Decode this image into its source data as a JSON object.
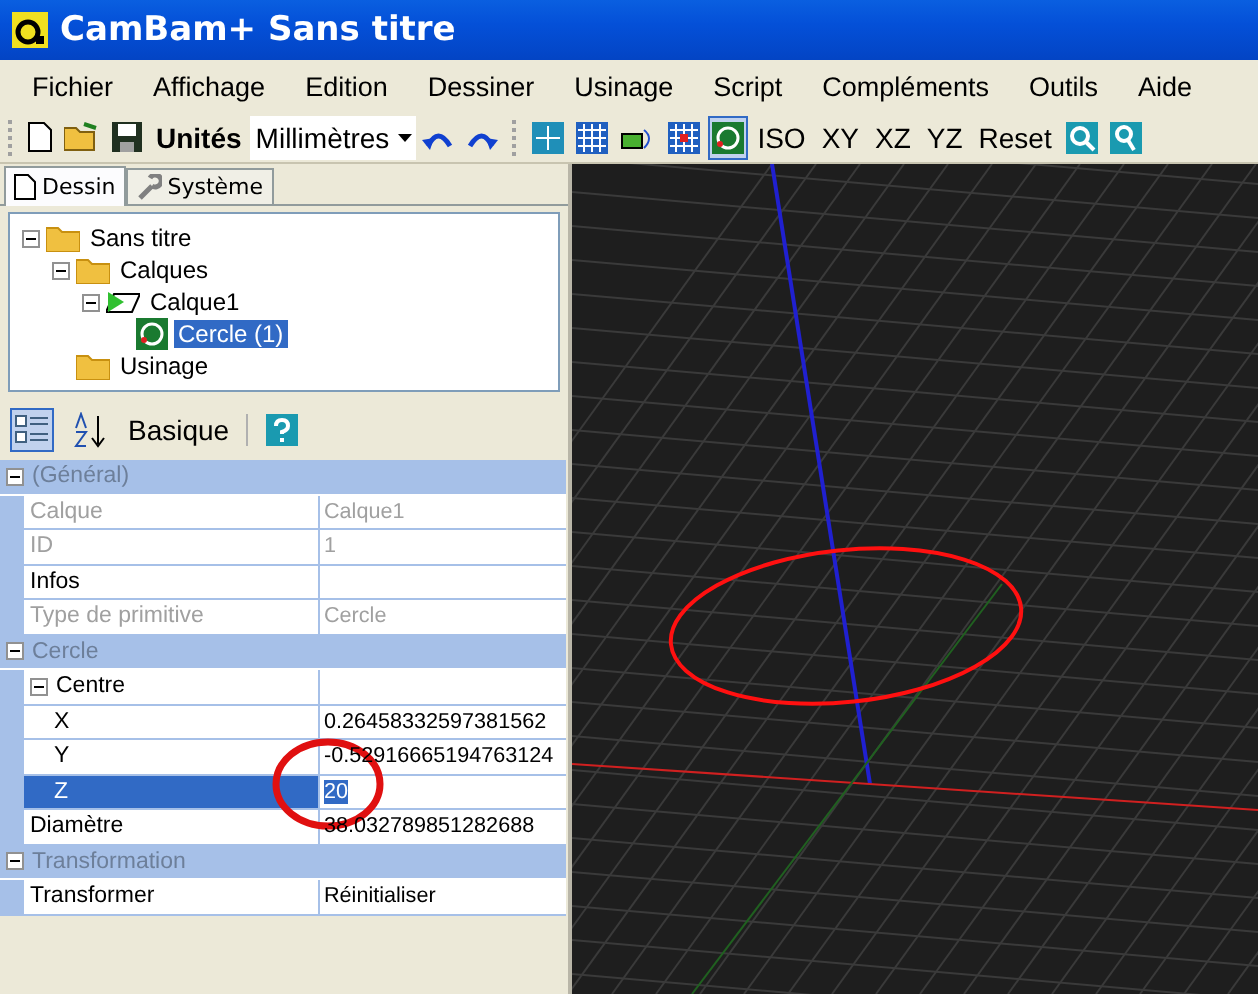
{
  "window": {
    "title": "CamBam+  Sans titre"
  },
  "menu": [
    "Fichier",
    "Affichage",
    "Edition",
    "Dessiner",
    "Usinage",
    "Script",
    "Compléments",
    "Outils",
    "Aide"
  ],
  "toolbar": {
    "units_label": "Unités",
    "units_value": "Millimètres",
    "view_buttons": [
      {
        "kind": "icon",
        "selected": false
      },
      {
        "kind": "icon",
        "selected": false
      },
      {
        "kind": "icon",
        "selected": false
      },
      {
        "kind": "icon",
        "selected": false
      },
      {
        "kind": "icon",
        "selected": true
      },
      {
        "kind": "text",
        "label": "ISO",
        "selected": false
      },
      {
        "kind": "text",
        "label": "XY",
        "selected": false
      },
      {
        "kind": "text",
        "label": "XZ",
        "selected": false
      },
      {
        "kind": "text",
        "label": "YZ",
        "selected": false
      },
      {
        "kind": "text",
        "label": "Reset",
        "selected": false
      },
      {
        "kind": "icon",
        "selected": false
      },
      {
        "kind": "icon",
        "selected": false
      }
    ]
  },
  "tabs": [
    {
      "label": "Dessin",
      "selected": true
    },
    {
      "label": "Système",
      "selected": false
    }
  ],
  "tree": [
    {
      "label": "Sans titre",
      "kind": "folder",
      "expanded": true,
      "selected": false,
      "children": [
        {
          "label": "Calques",
          "kind": "folder",
          "expanded": true,
          "selected": false,
          "children": [
            {
              "label": "Calque1",
              "kind": "layer",
              "expanded": true,
              "selected": false,
              "children": [
                {
                  "label": "Cercle (1)",
                  "kind": "shape",
                  "selected": true
                }
              ]
            }
          ]
        },
        {
          "label": "Usinage",
          "kind": "folder",
          "selected": false
        }
      ]
    }
  ],
  "properties_toolbar": {
    "sort_label": "Basique"
  },
  "properties": [
    {
      "kind": "category",
      "label": "(Général)",
      "expanded": true
    },
    {
      "kind": "property",
      "name": "Calque",
      "value": "Calque1",
      "disabled": true,
      "selected": false
    },
    {
      "kind": "property",
      "name": "ID",
      "value": "1",
      "disabled": true,
      "selected": false
    },
    {
      "kind": "property",
      "name": "Infos",
      "disabled": false,
      "selected": false
    },
    {
      "kind": "property",
      "name": "Type de primitive",
      "value": "Cercle",
      "disabled": true,
      "selected": false
    },
    {
      "kind": "category",
      "label": "Cercle",
      "expanded": true
    },
    {
      "kind": "group",
      "name": "Centre",
      "expanded": true
    },
    {
      "kind": "subproperty",
      "name": "X",
      "value": "0.26458332597381562",
      "disabled": false,
      "selected": false
    },
    {
      "kind": "subproperty",
      "name": "Y",
      "value": "-0.52916665194763124",
      "disabled": false,
      "selected": false
    },
    {
      "kind": "subproperty",
      "name": "Z",
      "value": "20",
      "disabled": false,
      "selected": true
    },
    {
      "kind": "property",
      "name": "Diamètre",
      "value": "38.032789851282688",
      "disabled": false,
      "selected": false
    },
    {
      "kind": "category",
      "label": "Transformation",
      "expanded": true
    },
    {
      "kind": "property",
      "name": "Transformer",
      "value": "Réinitialiser",
      "disabled": false,
      "selected": false
    }
  ]
}
